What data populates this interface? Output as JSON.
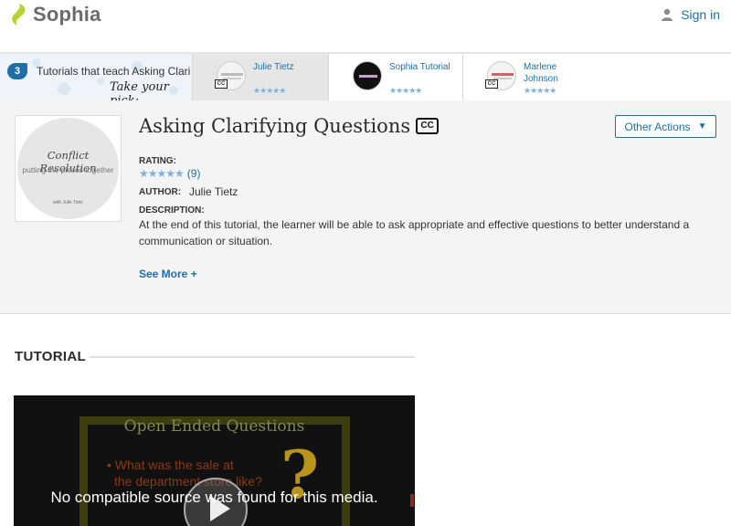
{
  "header": {
    "logo_text": "Sophia",
    "signin_label": "Sign in"
  },
  "tutorials_strip": {
    "count": "3",
    "title": "Tutorials that teach Asking Clarifying Questions",
    "pick_label": "Take your pick:",
    "cards": [
      {
        "name": "Julie Tietz",
        "stars": "★★★★★",
        "cc": "CC"
      },
      {
        "name": "Sophia Tutorial",
        "stars": "★★★★★"
      },
      {
        "name": "Marlene Johnson",
        "stars": "★★★★★",
        "cc": "CC"
      }
    ]
  },
  "tutorial": {
    "cover_title": "Conflict Resolution",
    "cover_subtitle": "putting the pieces together",
    "cover_author": "with Julie Tietz",
    "title": "Asking Clarifying Questions",
    "cc_badge": "CC",
    "rating_label": "RATING:",
    "rating_stars": "★★★★★",
    "rating_count": "(9)",
    "author_label": "AUTHOR:",
    "author": "Julie Tietz",
    "description_label": "DESCRIPTION:",
    "description": "At the end of this tutorial, the learner will be able to ask appropriate and effective questions to better understand a communication or situation.",
    "see_more": "See More +",
    "other_actions": "Other Actions"
  },
  "section": {
    "heading": "TUTORIAL"
  },
  "video": {
    "slide_title": "Open Ended Questions",
    "bullet_line1": "• What was the sale at",
    "bullet_line2": "the department store like?",
    "question_mark": "?",
    "message": "No compatible source was found for this media."
  },
  "colors": {
    "accent": "#1d6fa5",
    "star": "#7fb2d9",
    "logo_green": "#b5d334"
  }
}
